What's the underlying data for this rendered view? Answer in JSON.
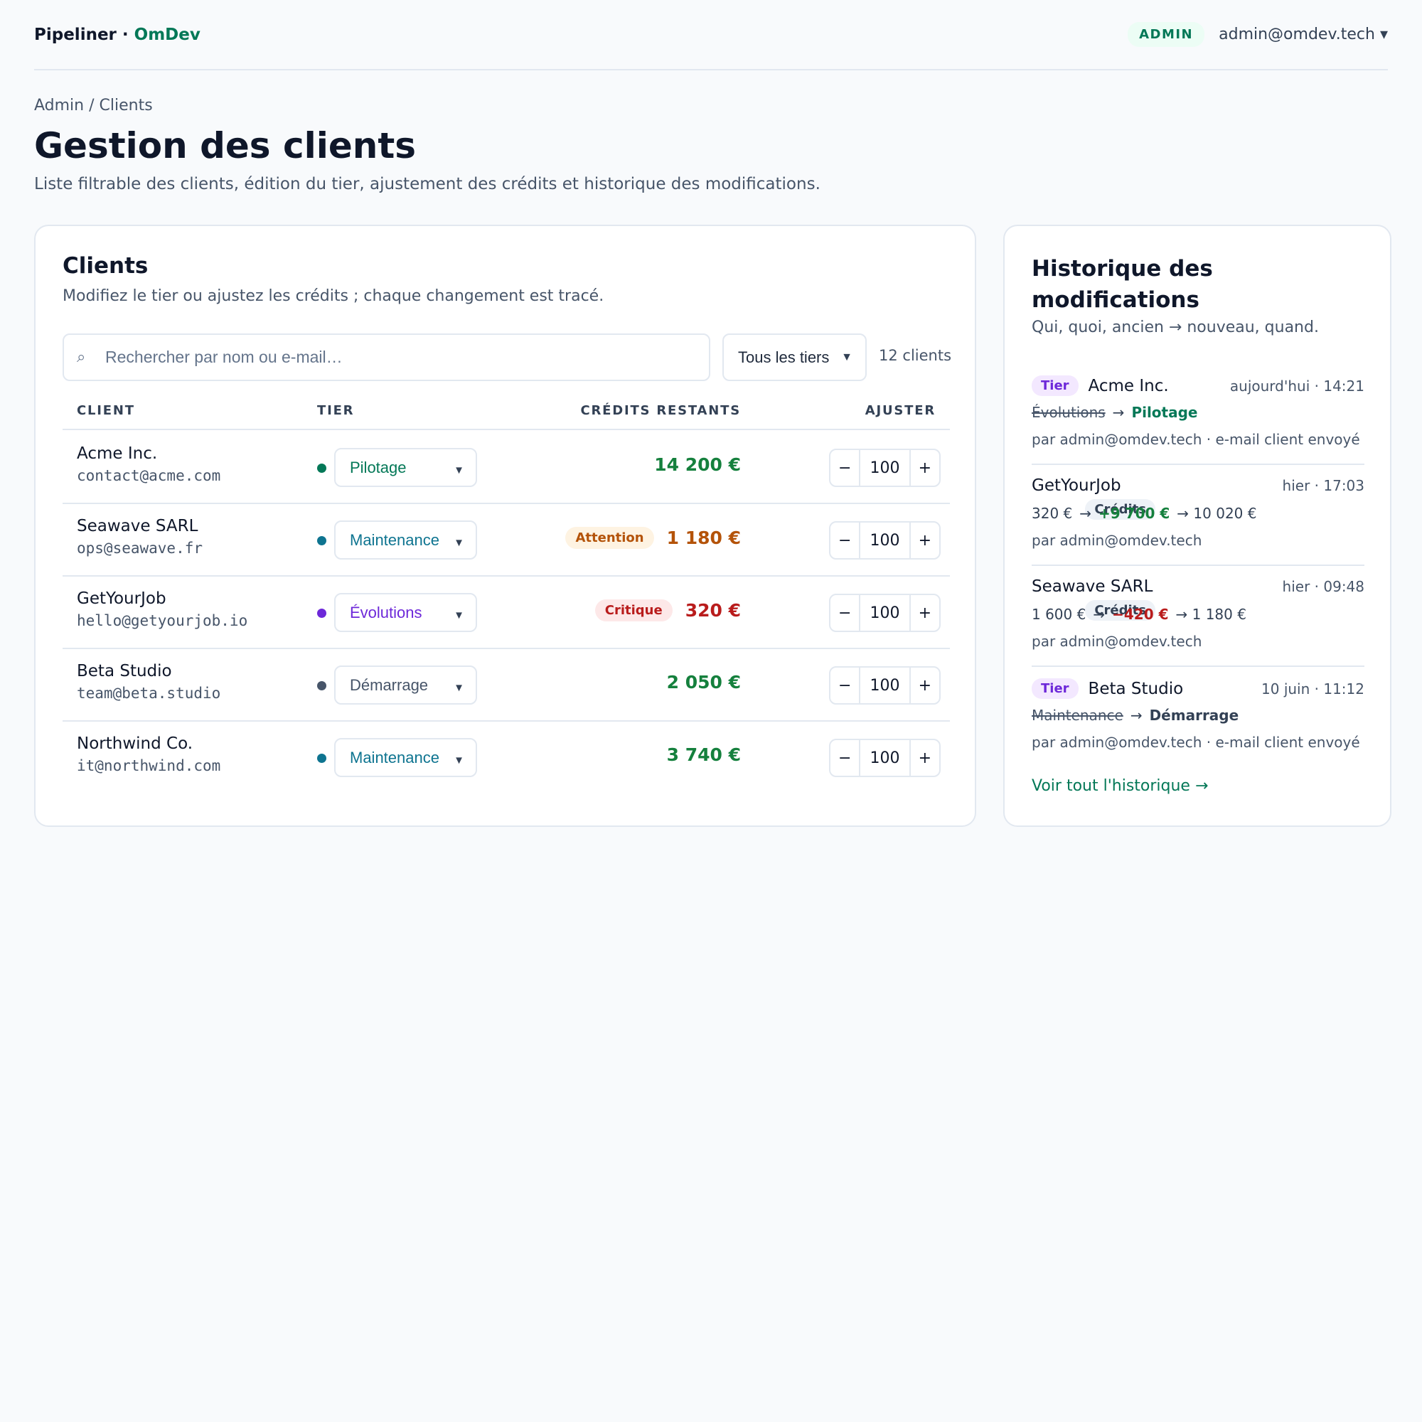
{
  "header": {
    "brand": "Pipeliner",
    "brand_sep": " · ",
    "org": "OmDev",
    "role_badge": "ADMIN",
    "user_email": "admin@omdev.tech ▾"
  },
  "breadcrumb": "Admin / Clients",
  "page_title": "Gestion des clients",
  "page_subtitle": "Liste filtrable des clients, édition du tier, ajustement des crédits et historique des modifications.",
  "clients_card": {
    "title": "Clients",
    "subtitle": "Modifiez le tier ou ajustez les crédits ; chaque changement est tracé.",
    "search_icon": "⌕",
    "search_placeholder": "Rechercher par nom ou e-mail…",
    "tier_filter": "Tous les tiers",
    "count": "12 clients",
    "columns": {
      "client": "CLIENT",
      "tier": "TIER",
      "credits": "CRÉDITS RESTANTS",
      "adjust": "AJUSTER"
    },
    "rows": [
      {
        "name": "Acme Inc.",
        "email": "contact@acme.com",
        "tier": "Pilotage",
        "tier_color": "#047857",
        "credits": "14 200 €",
        "credits_color": "#15803d",
        "badge": "",
        "step": "100"
      },
      {
        "name": "Seawave SARL",
        "email": "ops@seawave.fr",
        "tier": "Maintenance",
        "tier_color": "#0e7490",
        "credits": "1 180 €",
        "credits_color": "#b45309",
        "badge": "Attention",
        "step": "100"
      },
      {
        "name": "GetYourJob",
        "email": "hello@getyourjob.io",
        "tier": "Évolutions",
        "tier_color": "#6d28d9",
        "credits": "320 €",
        "credits_color": "#b91c1c",
        "badge": "Critique",
        "step": "100"
      },
      {
        "name": "Beta Studio",
        "email": "team@beta.studio",
        "tier": "Démarrage",
        "tier_color": "#475569",
        "credits": "2 050 €",
        "credits_color": "#15803d",
        "badge": "",
        "step": "100"
      },
      {
        "name": "Northwind Co.",
        "email": "it@northwind.com",
        "tier": "Maintenance",
        "tier_color": "#0e7490",
        "credits": "3 740 €",
        "credits_color": "#15803d",
        "badge": "",
        "step": "100"
      }
    ],
    "minus": "−",
    "plus": "+"
  },
  "history_card": {
    "title_line1": "Historique des",
    "title_line2": "modifications",
    "subtitle": "Qui, quoi, ancien → nouveau, quand.",
    "items": [
      {
        "kind": "Tier",
        "client": "Acme Inc.",
        "time": "aujourd'hui · 14:21",
        "old": "Évolutions",
        "arrow": "→",
        "new": "Pilotage",
        "by": "par admin@omdev.tech · e-mail client envoyé"
      },
      {
        "kind": "Crédits",
        "client": "GetYourJob",
        "time": "hier · 17:03",
        "old": "320 €",
        "arrow": "→",
        "new": "+9 700 €",
        "result": "→ 10 020 €",
        "by": "par admin@omdev.tech"
      },
      {
        "kind": "Crédits",
        "client": "Seawave SARL",
        "time": "hier · 09:48",
        "old": "1 600 €",
        "arrow": "→",
        "new": "−420 €",
        "result": "→ 1 180 €",
        "by": "par admin@omdev.tech"
      },
      {
        "kind": "Tier",
        "client": "Beta Studio",
        "time": "10 juin · 11:12",
        "old": "Maintenance",
        "arrow": "→",
        "new": "Démarrage",
        "by": "par admin@omdev.tech · e-mail client envoyé"
      }
    ],
    "see_all": "Voir tout l'historique →"
  },
  "colors": {
    "accent": "#047857",
    "attention_bg": "#fef3e2",
    "attention_fg": "#b45309",
    "critique_bg": "#fde8e8",
    "critique_fg": "#b91c1c"
  }
}
